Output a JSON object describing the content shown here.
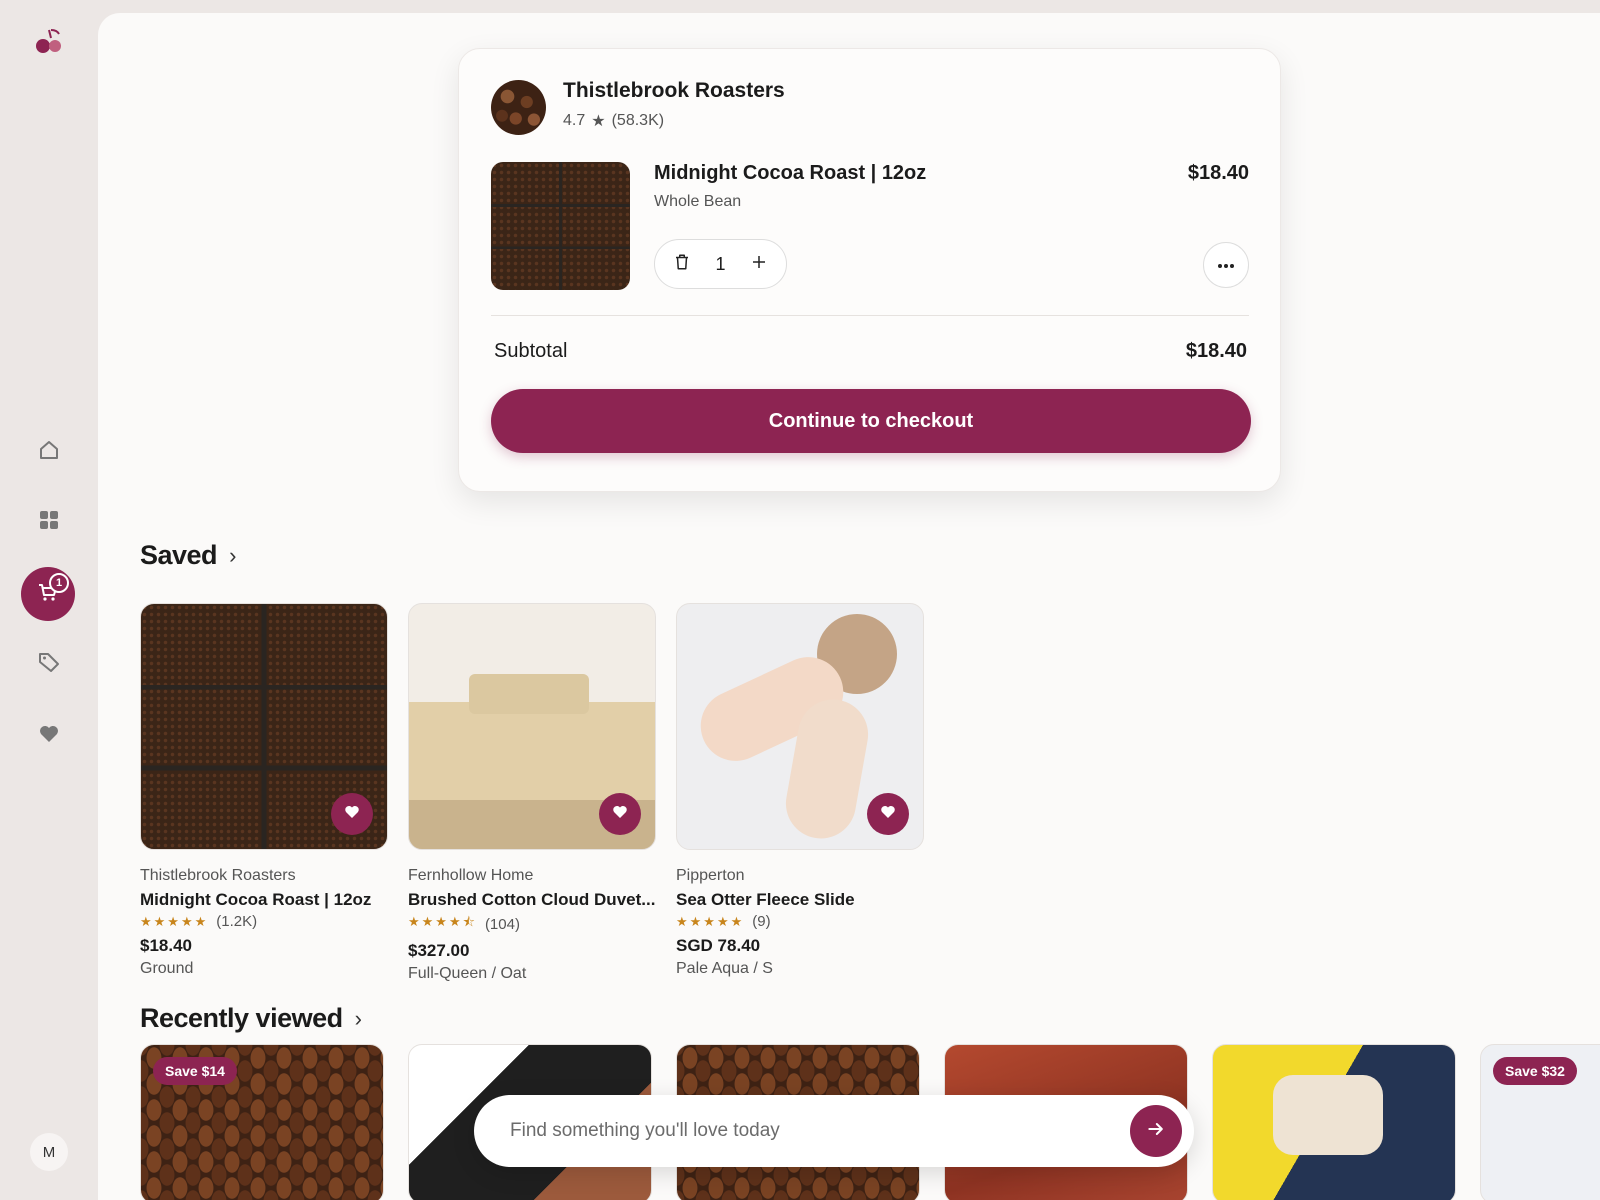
{
  "brand": {
    "logo_icon": "cherry-icon",
    "accent": "#8d2452"
  },
  "sidebar": {
    "items": [
      {
        "name": "home",
        "icon": "home-icon"
      },
      {
        "name": "categories",
        "icon": "grid-icon"
      },
      {
        "name": "cart",
        "icon": "cart-icon",
        "badge": "1",
        "active": true
      },
      {
        "name": "deals",
        "icon": "tag-icon"
      },
      {
        "name": "favorites",
        "icon": "heart-icon"
      }
    ],
    "avatar_initial": "M"
  },
  "cart": {
    "shop_name": "Thistlebrook Roasters",
    "shop_rating": "4.7",
    "shop_review_count": "(58.3K)",
    "item": {
      "title": "Midnight Cocoa Roast | 12oz",
      "variant": "Whole Bean",
      "price": "$18.40",
      "quantity": "1"
    },
    "subtotal_label": "Subtotal",
    "subtotal_value": "$18.40",
    "checkout_label": "Continue to checkout"
  },
  "saved": {
    "title": "Saved",
    "items": [
      {
        "shop": "Thistlebrook Roasters",
        "title": "Midnight Cocoa Roast | 12oz",
        "rating": 5,
        "stars": "★★★★★",
        "reviews": "(1.2K)",
        "price": "$18.40",
        "variant": "Ground"
      },
      {
        "shop": "Fernhollow Home",
        "title": "Brushed Cotton Cloud Duvet...",
        "rating": 4.5,
        "stars": "★★★★⯪",
        "reviews": "(104)",
        "price": "$327.00",
        "variant": "Full-Queen / Oat"
      },
      {
        "shop": "Pipperton",
        "title": "Sea Otter Fleece Slide",
        "rating": 5,
        "stars": "★★★★★",
        "reviews": "(9)",
        "price": "SGD 78.40",
        "variant": "Pale Aqua / S"
      }
    ]
  },
  "recently_viewed": {
    "title": "Recently viewed",
    "badges": [
      "Save $14",
      "Save $32"
    ]
  },
  "search": {
    "placeholder": "Find something you'll love today"
  }
}
